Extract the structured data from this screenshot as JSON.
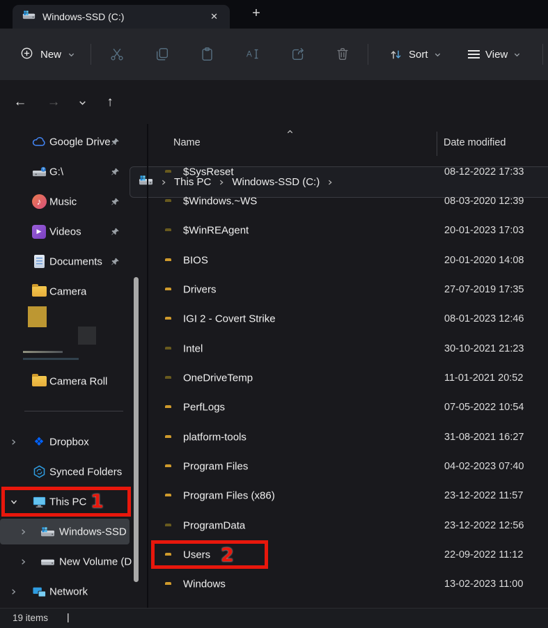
{
  "window": {
    "tab_title": "Windows-SSD (C:)",
    "close_glyph": "✕",
    "new_tab_glyph": "+"
  },
  "toolbar": {
    "new_label": "New",
    "sort_label": "Sort",
    "view_label": "View"
  },
  "navigation": {
    "back_glyph": "←",
    "forward_glyph": "→",
    "up_glyph": "↑"
  },
  "breadcrumb": {
    "segments": [
      "This PC",
      "Windows-SSD (C:)"
    ]
  },
  "list": {
    "columns": {
      "name": "Name",
      "date": "Date modified"
    }
  },
  "files": [
    {
      "name": "$SysReset",
      "date": "08-12-2022 17:33",
      "dim": true
    },
    {
      "name": "$Windows.~WS",
      "date": "08-03-2020 12:39",
      "dim": true
    },
    {
      "name": "$WinREAgent",
      "date": "20-01-2023 17:03",
      "dim": true
    },
    {
      "name": "BIOS",
      "date": "20-01-2020 14:08"
    },
    {
      "name": "Drivers",
      "date": "27-07-2019 17:35"
    },
    {
      "name": "IGI 2 - Covert Strike",
      "date": "08-01-2023 12:46"
    },
    {
      "name": "Intel",
      "date": "30-10-2021 21:23",
      "dim": true
    },
    {
      "name": "OneDriveTemp",
      "date": "11-01-2021 20:52",
      "dim": true
    },
    {
      "name": "PerfLogs",
      "date": "07-05-2022 10:54"
    },
    {
      "name": "platform-tools",
      "date": "31-08-2021 16:27"
    },
    {
      "name": "Program Files",
      "date": "04-02-2023 07:40"
    },
    {
      "name": "Program Files (x86)",
      "date": "23-12-2022 11:57"
    },
    {
      "name": "ProgramData",
      "date": "23-12-2022 12:56",
      "dim": true
    },
    {
      "name": "Users",
      "date": "22-09-2022 11:12",
      "annotation": "2",
      "boxed": true
    },
    {
      "name": "Windows",
      "date": "13-02-2023 11:00"
    }
  ],
  "sidebar": {
    "items": [
      {
        "label": "Google Drive",
        "icon": "google-drive",
        "pinned": true
      },
      {
        "label": "G:\\",
        "icon": "drive-g",
        "pinned": true
      },
      {
        "label": "Music",
        "icon": "music",
        "pinned": true
      },
      {
        "label": "Videos",
        "icon": "videos",
        "pinned": true
      },
      {
        "label": "Documents",
        "icon": "documents",
        "pinned": true
      },
      {
        "label": "Camera",
        "icon": "folder"
      },
      {
        "type": "thumbs"
      },
      {
        "label": "Camera Roll",
        "icon": "folder"
      },
      {
        "type": "divider"
      },
      {
        "label": "Dropbox",
        "icon": "dropbox",
        "chevron": "right"
      },
      {
        "label": "Synced Folders",
        "icon": "synced"
      },
      {
        "label": "This PC",
        "icon": "this-pc",
        "chevron": "down",
        "annotation": "1",
        "boxed": true
      },
      {
        "label": "Windows-SSD",
        "icon": "drive-win",
        "chevron": "right",
        "selected": true,
        "indent": true
      },
      {
        "label": "New Volume (D",
        "icon": "drive",
        "chevron": "right",
        "indent": true
      },
      {
        "label": "Network",
        "icon": "network",
        "chevron": "right"
      }
    ]
  },
  "statusbar": {
    "count": "19 items",
    "cursor": "|"
  },
  "colors": {
    "highlight_red": "#e8170c",
    "folder_yellow": "#f4c84e",
    "accent_blue": "#58a7de",
    "selection_bg": "#3a3d42"
  }
}
